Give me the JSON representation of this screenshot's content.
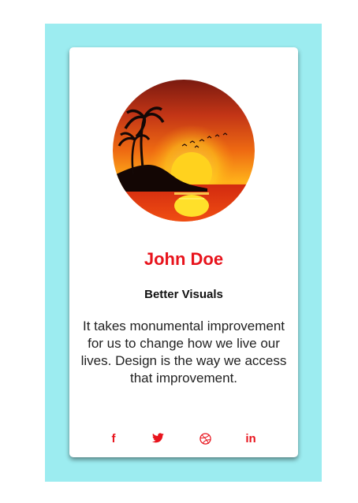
{
  "profile": {
    "name": "John Doe",
    "title": "Better Visuals",
    "quote": "It takes monumental improvement for us to change how we live our lives. Design is the way we access that improvement."
  },
  "social_links": [
    {
      "icon": "facebook-icon",
      "label": "f"
    },
    {
      "icon": "twitter-icon",
      "label": ""
    },
    {
      "icon": "dribbble-icon",
      "label": ""
    },
    {
      "icon": "linkedin-icon",
      "label": "in"
    }
  ],
  "colors": {
    "frame_background": "#9cecf0",
    "card_background": "#ffffff",
    "accent": "#e8131c"
  }
}
